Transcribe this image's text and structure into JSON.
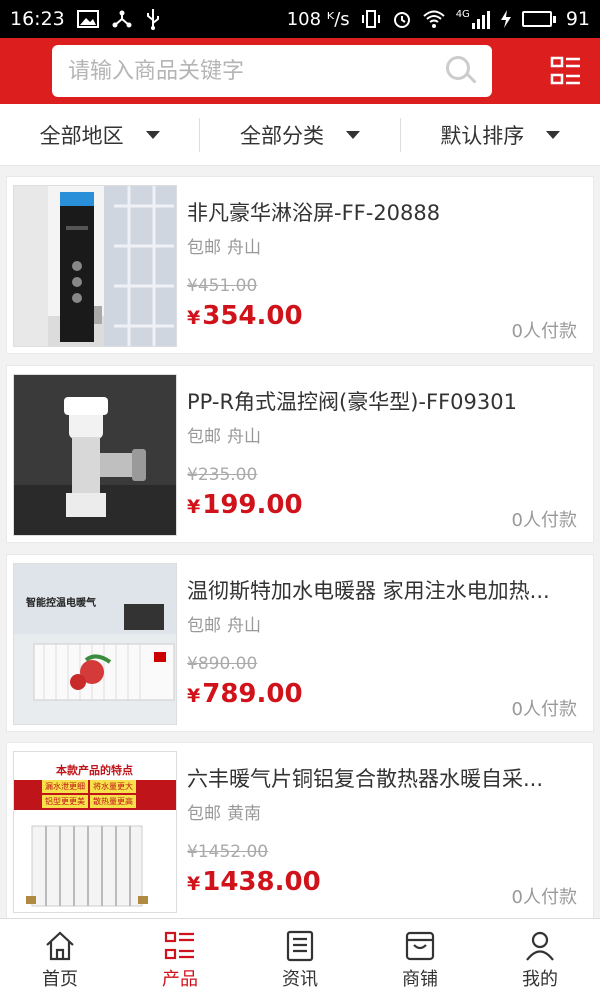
{
  "status_bar": {
    "time": "16:23",
    "network_speed": "108 ᴷ/s",
    "signal_label": "4G",
    "battery": "91",
    "battery_level": 0.91
  },
  "header": {
    "search_placeholder": "请输入商品关键字"
  },
  "filters": [
    {
      "label": "全部地区"
    },
    {
      "label": "全部分类"
    },
    {
      "label": "默认排序"
    }
  ],
  "products": [
    {
      "title": "非凡豪华淋浴屏-FF-20888",
      "shipping": "包邮",
      "location": "舟山",
      "old_price": "¥451.00",
      "currency": "¥",
      "price": "354.00",
      "paid": "0人付款"
    },
    {
      "title": "PP-R角式温控阀(豪华型)-FF09301",
      "shipping": "包邮",
      "location": "舟山",
      "old_price": "¥235.00",
      "currency": "¥",
      "price": "199.00",
      "paid": "0人付款"
    },
    {
      "title": "温彻斯特加水电暖器 家用注水电加热...",
      "shipping": "包邮",
      "location": "舟山",
      "old_price": "¥890.00",
      "currency": "¥",
      "price": "789.00",
      "paid": "0人付款",
      "image_text": "智能控温电暖气"
    },
    {
      "title": "六丰暖气片铜铝复合散热器水暖自采...",
      "shipping": "包邮",
      "location": "黄南",
      "old_price": "¥1452.00",
      "currency": "¥",
      "price": "1438.00",
      "paid": "0人付款",
      "image_text": "本款产品的特点",
      "image_tags": [
        "漏水泄更细",
        "将水量更大",
        "铝型更更美",
        "散热量更高"
      ]
    }
  ],
  "bottom_nav": [
    {
      "label": "首页",
      "icon": "home-icon"
    },
    {
      "label": "产品",
      "icon": "list-icon",
      "active": true
    },
    {
      "label": "资讯",
      "icon": "news-icon"
    },
    {
      "label": "商铺",
      "icon": "shop-icon"
    },
    {
      "label": "我的",
      "icon": "user-icon"
    }
  ],
  "colors": {
    "brand_red": "#dd1e1e",
    "price_red": "#d0121a",
    "battery_green": "#3ecb3e"
  }
}
